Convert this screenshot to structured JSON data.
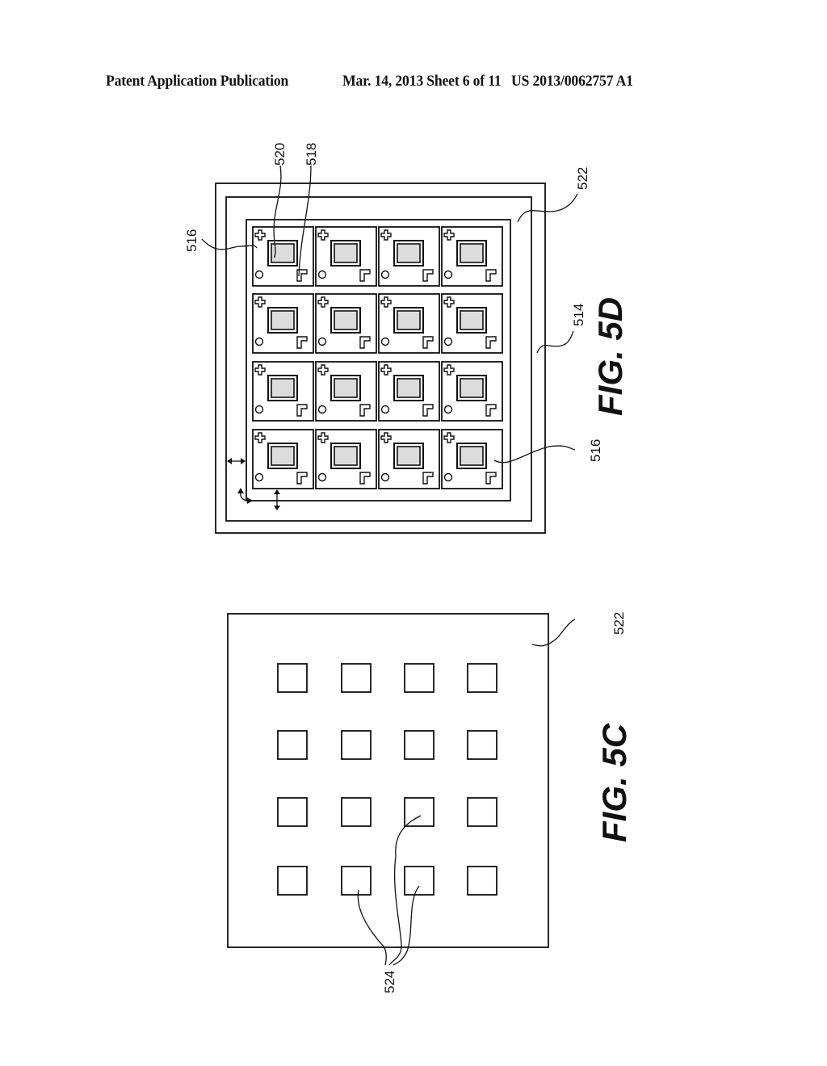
{
  "header": {
    "left": "Patent Application Publication",
    "middle": "Mar. 14, 2013  Sheet 6 of 11",
    "right": "US 2013/0062757 A1"
  },
  "figures": [
    {
      "id": "fig_5d",
      "label": "FIG. 5D",
      "grid": {
        "rows": 4,
        "cols": 4
      },
      "cell_features": [
        "cross-mark",
        "circle-mark",
        "corner-mark",
        "shaded-die"
      ],
      "reference_numerals": {
        "top_left_cell": "516",
        "shaded_die": "520",
        "corner_mark": "518",
        "frame": "522",
        "substrate": "514",
        "bottom_right_cell": "516"
      }
    },
    {
      "id": "fig_5c",
      "label": "FIG. 5C",
      "grid": {
        "rows": 4,
        "cols": 4
      },
      "reference_numerals": {
        "frame": "522",
        "openings": "524"
      }
    }
  ]
}
